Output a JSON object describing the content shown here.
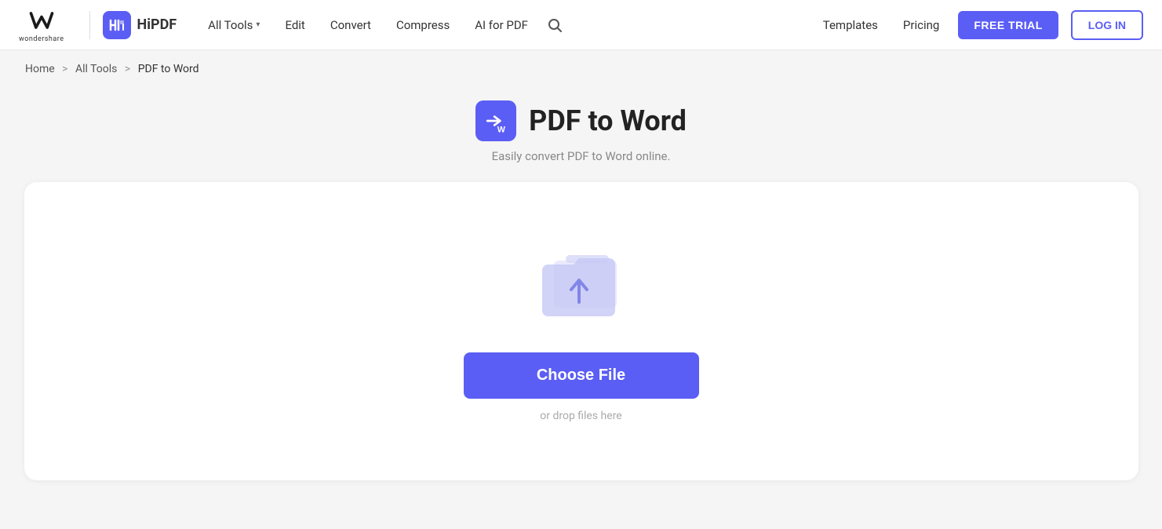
{
  "brand": {
    "wondershare_text": "wondershare",
    "hipdf_label": "HiPDF"
  },
  "nav": {
    "all_tools_label": "All Tools",
    "edit_label": "Edit",
    "convert_label": "Convert",
    "compress_label": "Compress",
    "ai_for_pdf_label": "AI for PDF"
  },
  "header_right": {
    "templates_label": "Templates",
    "pricing_label": "Pricing",
    "free_trial_label": "FREE TRIAL",
    "login_label": "LOG IN"
  },
  "breadcrumb": {
    "home": "Home",
    "all_tools": "All Tools",
    "current": "PDF to Word"
  },
  "page": {
    "title": "PDF to Word",
    "subtitle": "Easily convert PDF to Word online."
  },
  "dropzone": {
    "choose_file_label": "Choose File",
    "drop_hint": "or drop files here"
  }
}
